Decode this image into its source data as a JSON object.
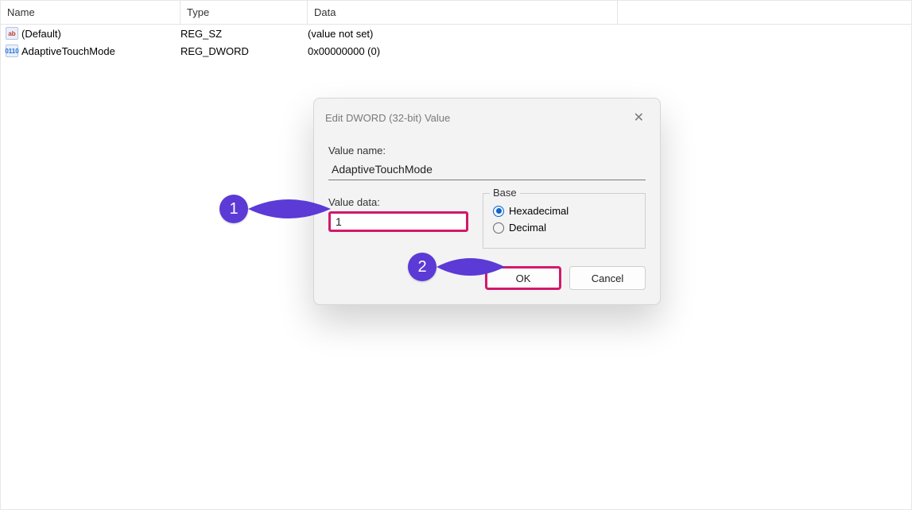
{
  "columns": {
    "name": "Name",
    "type": "Type",
    "data": "Data"
  },
  "rows": [
    {
      "icon": "ab",
      "name": "(Default)",
      "type": "REG_SZ",
      "data": "(value not set)"
    },
    {
      "icon": "0110",
      "name": "AdaptiveTouchMode",
      "type": "REG_DWORD",
      "data": "0x00000000 (0)"
    }
  ],
  "dialog": {
    "title": "Edit DWORD (32-bit) Value",
    "value_name_label": "Value name:",
    "value_name": "AdaptiveTouchMode",
    "value_data_label": "Value data:",
    "value_data": "1",
    "base_label": "Base",
    "radio_hex": "Hexadecimal",
    "radio_dec": "Decimal",
    "ok": "OK",
    "cancel": "Cancel"
  },
  "annotations": {
    "step1": "1",
    "step2": "2"
  }
}
